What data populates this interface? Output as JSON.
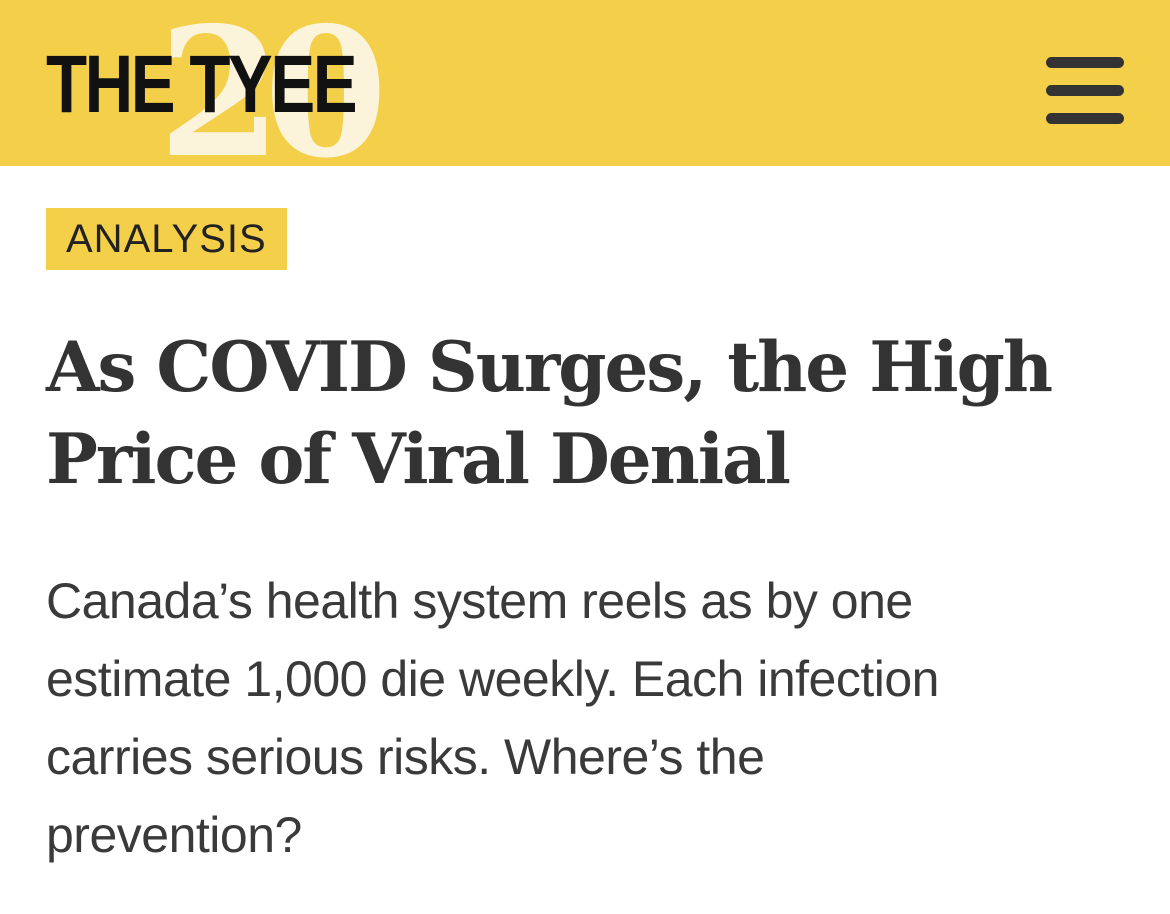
{
  "header": {
    "brand": "THE TYEE",
    "anniversary_mark": "20",
    "background_color": "#f4d04a",
    "menu_icon": "hamburger-menu-icon"
  },
  "article": {
    "category": "ANALYSIS",
    "headline_line1": "As COVID Surges, the High",
    "headline_line2": "Price of Viral Denial",
    "dek_line1": "Canada’s health system reels as by one",
    "dek_line2": "estimate 1,000 die weekly. Each infection",
    "dek_line3": "carries serious risks. Where’s the",
    "dek_line4": "prevention?"
  }
}
